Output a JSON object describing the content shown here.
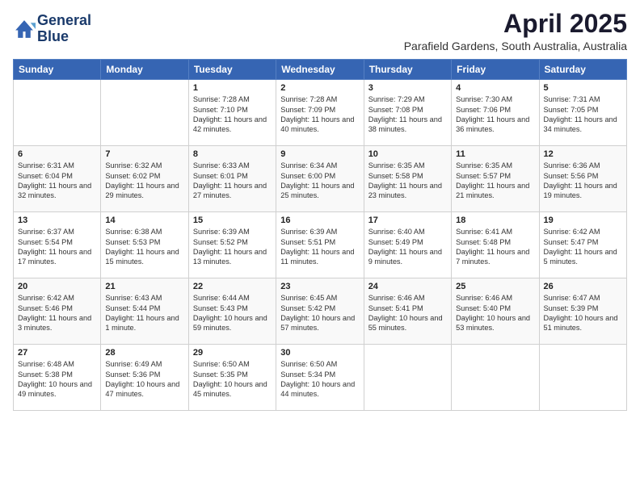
{
  "logo": {
    "line1": "General",
    "line2": "Blue"
  },
  "title": "April 2025",
  "location": "Parafield Gardens, South Australia, Australia",
  "weekdays": [
    "Sunday",
    "Monday",
    "Tuesday",
    "Wednesday",
    "Thursday",
    "Friday",
    "Saturday"
  ],
  "weeks": [
    [
      {
        "day": "",
        "sunrise": "",
        "sunset": "",
        "daylight": ""
      },
      {
        "day": "",
        "sunrise": "",
        "sunset": "",
        "daylight": ""
      },
      {
        "day": "1",
        "sunrise": "Sunrise: 7:28 AM",
        "sunset": "Sunset: 7:10 PM",
        "daylight": "Daylight: 11 hours and 42 minutes."
      },
      {
        "day": "2",
        "sunrise": "Sunrise: 7:28 AM",
        "sunset": "Sunset: 7:09 PM",
        "daylight": "Daylight: 11 hours and 40 minutes."
      },
      {
        "day": "3",
        "sunrise": "Sunrise: 7:29 AM",
        "sunset": "Sunset: 7:08 PM",
        "daylight": "Daylight: 11 hours and 38 minutes."
      },
      {
        "day": "4",
        "sunrise": "Sunrise: 7:30 AM",
        "sunset": "Sunset: 7:06 PM",
        "daylight": "Daylight: 11 hours and 36 minutes."
      },
      {
        "day": "5",
        "sunrise": "Sunrise: 7:31 AM",
        "sunset": "Sunset: 7:05 PM",
        "daylight": "Daylight: 11 hours and 34 minutes."
      }
    ],
    [
      {
        "day": "6",
        "sunrise": "Sunrise: 6:31 AM",
        "sunset": "Sunset: 6:04 PM",
        "daylight": "Daylight: 11 hours and 32 minutes."
      },
      {
        "day": "7",
        "sunrise": "Sunrise: 6:32 AM",
        "sunset": "Sunset: 6:02 PM",
        "daylight": "Daylight: 11 hours and 29 minutes."
      },
      {
        "day": "8",
        "sunrise": "Sunrise: 6:33 AM",
        "sunset": "Sunset: 6:01 PM",
        "daylight": "Daylight: 11 hours and 27 minutes."
      },
      {
        "day": "9",
        "sunrise": "Sunrise: 6:34 AM",
        "sunset": "Sunset: 6:00 PM",
        "daylight": "Daylight: 11 hours and 25 minutes."
      },
      {
        "day": "10",
        "sunrise": "Sunrise: 6:35 AM",
        "sunset": "Sunset: 5:58 PM",
        "daylight": "Daylight: 11 hours and 23 minutes."
      },
      {
        "day": "11",
        "sunrise": "Sunrise: 6:35 AM",
        "sunset": "Sunset: 5:57 PM",
        "daylight": "Daylight: 11 hours and 21 minutes."
      },
      {
        "day": "12",
        "sunrise": "Sunrise: 6:36 AM",
        "sunset": "Sunset: 5:56 PM",
        "daylight": "Daylight: 11 hours and 19 minutes."
      }
    ],
    [
      {
        "day": "13",
        "sunrise": "Sunrise: 6:37 AM",
        "sunset": "Sunset: 5:54 PM",
        "daylight": "Daylight: 11 hours and 17 minutes."
      },
      {
        "day": "14",
        "sunrise": "Sunrise: 6:38 AM",
        "sunset": "Sunset: 5:53 PM",
        "daylight": "Daylight: 11 hours and 15 minutes."
      },
      {
        "day": "15",
        "sunrise": "Sunrise: 6:39 AM",
        "sunset": "Sunset: 5:52 PM",
        "daylight": "Daylight: 11 hours and 13 minutes."
      },
      {
        "day": "16",
        "sunrise": "Sunrise: 6:39 AM",
        "sunset": "Sunset: 5:51 PM",
        "daylight": "Daylight: 11 hours and 11 minutes."
      },
      {
        "day": "17",
        "sunrise": "Sunrise: 6:40 AM",
        "sunset": "Sunset: 5:49 PM",
        "daylight": "Daylight: 11 hours and 9 minutes."
      },
      {
        "day": "18",
        "sunrise": "Sunrise: 6:41 AM",
        "sunset": "Sunset: 5:48 PM",
        "daylight": "Daylight: 11 hours and 7 minutes."
      },
      {
        "day": "19",
        "sunrise": "Sunrise: 6:42 AM",
        "sunset": "Sunset: 5:47 PM",
        "daylight": "Daylight: 11 hours and 5 minutes."
      }
    ],
    [
      {
        "day": "20",
        "sunrise": "Sunrise: 6:42 AM",
        "sunset": "Sunset: 5:46 PM",
        "daylight": "Daylight: 11 hours and 3 minutes."
      },
      {
        "day": "21",
        "sunrise": "Sunrise: 6:43 AM",
        "sunset": "Sunset: 5:44 PM",
        "daylight": "Daylight: 11 hours and 1 minute."
      },
      {
        "day": "22",
        "sunrise": "Sunrise: 6:44 AM",
        "sunset": "Sunset: 5:43 PM",
        "daylight": "Daylight: 10 hours and 59 minutes."
      },
      {
        "day": "23",
        "sunrise": "Sunrise: 6:45 AM",
        "sunset": "Sunset: 5:42 PM",
        "daylight": "Daylight: 10 hours and 57 minutes."
      },
      {
        "day": "24",
        "sunrise": "Sunrise: 6:46 AM",
        "sunset": "Sunset: 5:41 PM",
        "daylight": "Daylight: 10 hours and 55 minutes."
      },
      {
        "day": "25",
        "sunrise": "Sunrise: 6:46 AM",
        "sunset": "Sunset: 5:40 PM",
        "daylight": "Daylight: 10 hours and 53 minutes."
      },
      {
        "day": "26",
        "sunrise": "Sunrise: 6:47 AM",
        "sunset": "Sunset: 5:39 PM",
        "daylight": "Daylight: 10 hours and 51 minutes."
      }
    ],
    [
      {
        "day": "27",
        "sunrise": "Sunrise: 6:48 AM",
        "sunset": "Sunset: 5:38 PM",
        "daylight": "Daylight: 10 hours and 49 minutes."
      },
      {
        "day": "28",
        "sunrise": "Sunrise: 6:49 AM",
        "sunset": "Sunset: 5:36 PM",
        "daylight": "Daylight: 10 hours and 47 minutes."
      },
      {
        "day": "29",
        "sunrise": "Sunrise: 6:50 AM",
        "sunset": "Sunset: 5:35 PM",
        "daylight": "Daylight: 10 hours and 45 minutes."
      },
      {
        "day": "30",
        "sunrise": "Sunrise: 6:50 AM",
        "sunset": "Sunset: 5:34 PM",
        "daylight": "Daylight: 10 hours and 44 minutes."
      },
      {
        "day": "",
        "sunrise": "",
        "sunset": "",
        "daylight": ""
      },
      {
        "day": "",
        "sunrise": "",
        "sunset": "",
        "daylight": ""
      },
      {
        "day": "",
        "sunrise": "",
        "sunset": "",
        "daylight": ""
      }
    ]
  ]
}
